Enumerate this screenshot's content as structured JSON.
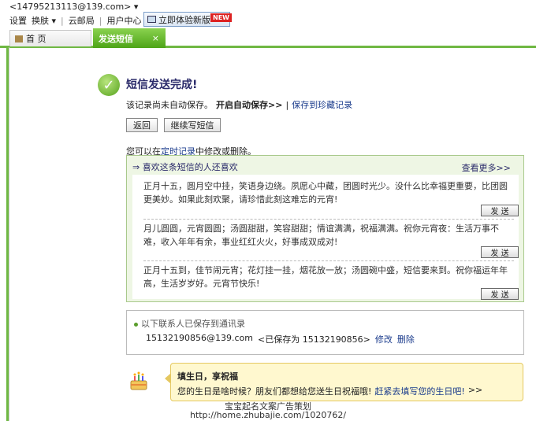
{
  "header": {
    "account": "<14795213113@139.com>",
    "menu": [
      "设置",
      "换肤",
      "云邮局",
      "用户中心"
    ],
    "try_new": "立即体验新版",
    "new_tag": "NEW"
  },
  "tabs": [
    {
      "label": "首 页"
    },
    {
      "label": "发送短信",
      "close": "×"
    }
  ],
  "result": {
    "title": "短信发送完成!",
    "note": "该记录尚未自动保存。",
    "auto_save": "开启自动保存>>",
    "divider": "|",
    "save_fav": "保存到珍藏记录",
    "back_btn": "返回",
    "continue_btn": "继续写短信",
    "hint_pre": "您可以在",
    "hint_link": "定时记录",
    "hint_post": "中修改或删除。"
  },
  "liked": {
    "heading": "⇒ 喜欢这条短信的人还喜欢",
    "more": "查看更多>>",
    "items": [
      {
        "text": "正月十五，圆月空中挂，笑语身边绕。夙愿心中藏，团圆时光少。没什么比幸福更重要，比团圆更美妙。如果此刻欢聚，请珍惜此刻这难忘的元宵!",
        "send": "发 送"
      },
      {
        "text": "月儿圆圆，元宵圆圆；汤圆甜甜，笑容甜甜；情谊满满，祝福满满。祝你元宵夜：生活万事不难，收入年年有余，事业红红火火，好事成双成对!",
        "send": "发 送"
      },
      {
        "text": "正月十五到，佳节闹元宵；花灯挂一挂，烟花放一放；汤圆碗中盛，短信要来到。祝你福运年年高，生活岁岁好。元宵节快乐!",
        "send": "发 送"
      }
    ]
  },
  "contacts": {
    "heading": "以下联系人已保存到通讯录",
    "email": "15132190856@139.com",
    "saved_as": "<已保存为 15132190856>",
    "edit": "修改",
    "delete": "删除"
  },
  "birthday": {
    "title": "填生日，享祝福",
    "question": "您的生日是啥时候？朋友们都想给您送生日祝福哦!",
    "link": "赶紧去填写您的生日吧!",
    "arrow": ">>"
  },
  "watermark": {
    "line1": "宝宝起名文案广告策划",
    "line2": "http://home.zhubajie.com/1020762/"
  }
}
